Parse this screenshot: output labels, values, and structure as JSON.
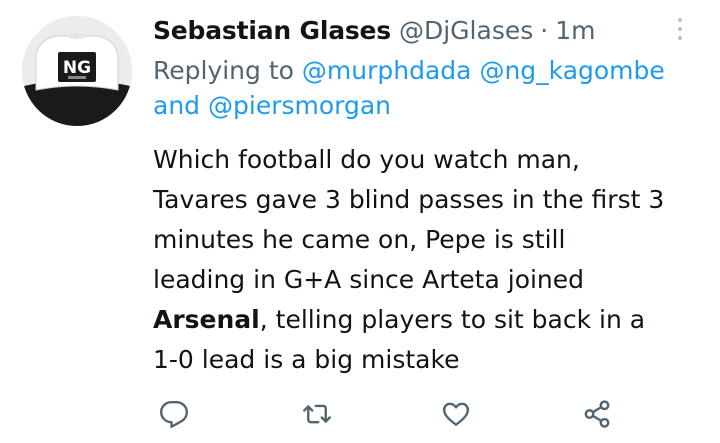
{
  "tweet": {
    "author": {
      "display_name": "Sebastian Glases",
      "handle": "@DjGlases",
      "avatar_icon": "cap-logo-avatar"
    },
    "separator": "·",
    "time": "1m",
    "reply": {
      "prefix": "Replying to",
      "mention_1": "@murphdada",
      "mention_2": "@ng_kagombe",
      "connector": "and",
      "mention_3": "@piersmorgan"
    },
    "text": {
      "line_1": "Which football do you watch man,",
      "line_2": "Tavares gave 3 blind passes in the first 3",
      "line_3": "minutes he came on, Pepe is still",
      "line_4": "leading in G+A since Arteta joined",
      "line_5_bold": "Arsenal",
      "line_5_rest": ", telling players to sit back in a",
      "line_6": "1-0 lead is a big mistake"
    },
    "actions": {
      "reply_icon": "comment-icon",
      "retweet_icon": "retweet-icon",
      "like_icon": "heart-icon",
      "share_icon": "share-icon"
    }
  },
  "colors": {
    "text_primary": "#0f1419",
    "text_secondary": "#536471",
    "link": "#1d9bf0",
    "more_dots": "#b8c2cc"
  }
}
